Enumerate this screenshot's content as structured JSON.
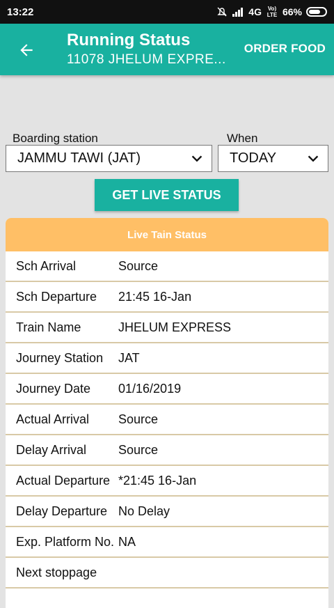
{
  "statusbar": {
    "time": "13:22",
    "network": "4G",
    "lte": "Vo) LTE",
    "battery": "66%"
  },
  "appbar": {
    "title": "Running Status",
    "subtitle": "11078 JHELUM EXPRE...",
    "order_food": "ORDER FOOD"
  },
  "form": {
    "boarding_label": "Boarding station",
    "boarding_value": "JAMMU TAWI (JAT)",
    "when_label": "When",
    "when_value": "TODAY",
    "button": "GET LIVE STATUS"
  },
  "card": {
    "header": "Live Tain Status",
    "rows": [
      {
        "key": "Sch Arrival",
        "value": "Source"
      },
      {
        "key": "Sch Departure",
        "value": "21:45 16-Jan"
      },
      {
        "key": "Train Name",
        "value": "JHELUM EXPRESS"
      },
      {
        "key": "Journey Station",
        "value": "JAT"
      },
      {
        "key": "Journey Date",
        "value": "01/16/2019"
      },
      {
        "key": "Actual Arrival",
        "value": "Source"
      },
      {
        "key": "Delay Arrival",
        "value": "Source"
      },
      {
        "key": "Actual Departure",
        "value": "*21:45 16-Jan"
      },
      {
        "key": "Delay Departure",
        "value": "No Delay"
      },
      {
        "key": "Exp. Platform No.",
        "value": "NA"
      },
      {
        "key": "Next stoppage",
        "value": ""
      }
    ]
  }
}
